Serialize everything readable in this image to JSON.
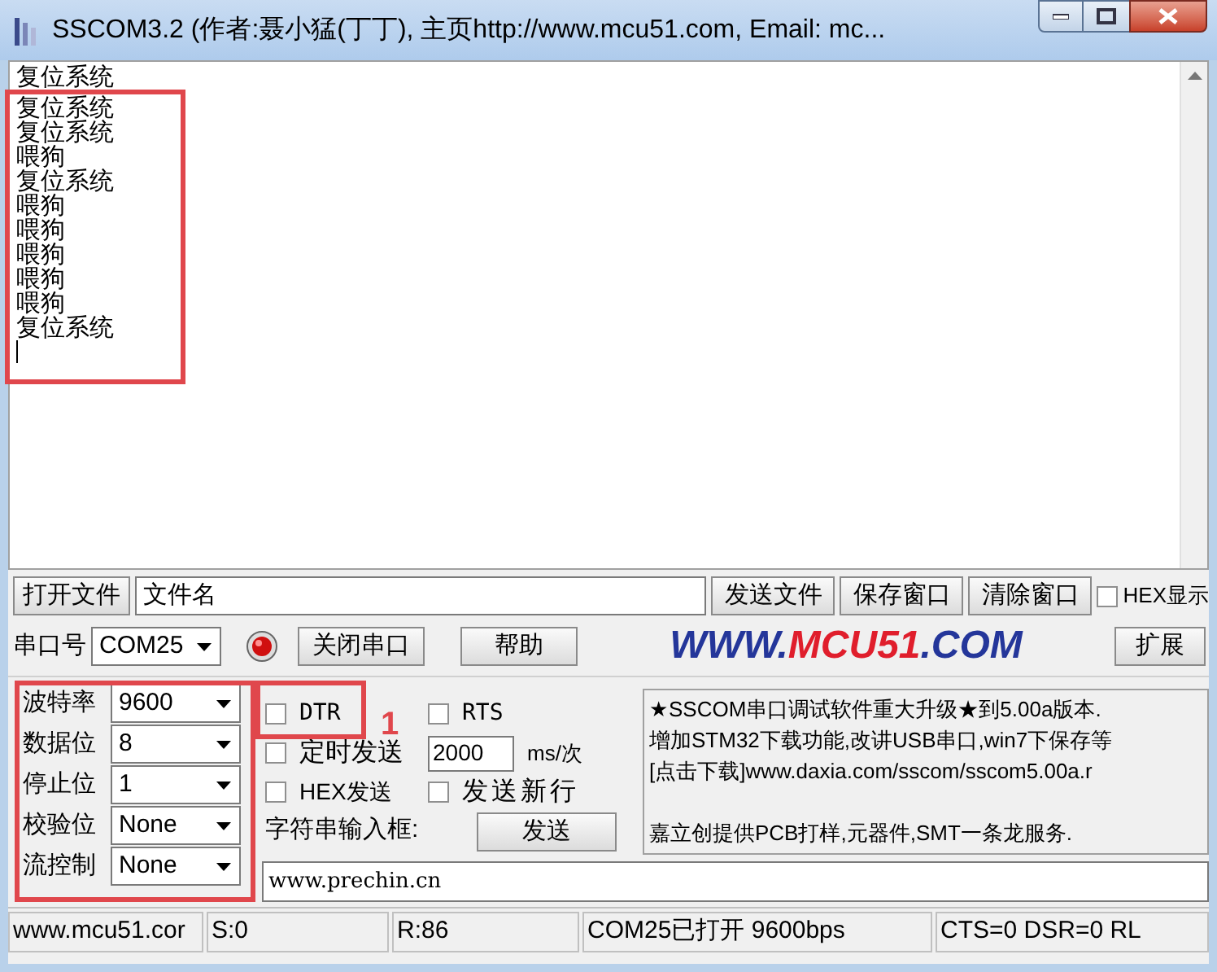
{
  "window": {
    "title": "SSCOM3.2 (作者:聂小猛(丁丁), 主页http://www.mcu51.com,  Email: mc..."
  },
  "receive": {
    "lines": [
      "复位系统",
      "复位系统",
      "复位系统",
      "喂狗",
      "复位系统",
      "喂狗",
      "喂狗",
      "喂狗",
      "喂狗",
      "喂狗",
      "复位系统"
    ]
  },
  "file_row": {
    "open_file": "打开文件",
    "filename": "文件名",
    "send_file": "发送文件",
    "save_window": "保存窗口",
    "clear_window": "清除窗口",
    "hex_display": {
      "label": "HEX显示",
      "checked": false
    }
  },
  "port_row": {
    "label": "串口号",
    "port": "COM25",
    "port_open": true,
    "close_port": "关闭串口",
    "help": "帮助",
    "logo": [
      "WWW.",
      "MCU51",
      ".COM"
    ],
    "expand": "扩展"
  },
  "settings": [
    {
      "label": "波特率",
      "value": "9600"
    },
    {
      "label": "数据位",
      "value": "8"
    },
    {
      "label": "停止位",
      "value": "1"
    },
    {
      "label": "校验位",
      "value": "None"
    },
    {
      "label": "流控制",
      "value": "None"
    }
  ],
  "options": {
    "dtr": {
      "label": "DTR",
      "checked": false
    },
    "rts": {
      "label": "RTS",
      "checked": false
    },
    "timed_send": {
      "label": "定时发送",
      "checked": false
    },
    "interval": "2000",
    "interval_unit": "ms/次",
    "hex_send": {
      "label": "HEX发送",
      "checked": false
    },
    "send_newline": {
      "label": "发送新行",
      "checked": false
    },
    "input_label": "字符串输入框:",
    "send": "发送",
    "input_value": "www.prechin.cn"
  },
  "ad_lines": [
    "★SSCOM串口调试软件重大升级★到5.00a版本.",
    "增加STM32下载功能,改讲USB串口,win7下保存等",
    "[点击下载]www.daxia.com/sscom/sscom5.00a.r",
    "嘉立创提供PCB打样,元器件,SMT一条龙服务."
  ],
  "status_bar": [
    "www.mcu51.cor",
    "S:0",
    "R:86",
    "COM25已打开  9600bps",
    "CTS=0 DSR=0 RL"
  ],
  "annotations": {
    "marker": "1"
  }
}
